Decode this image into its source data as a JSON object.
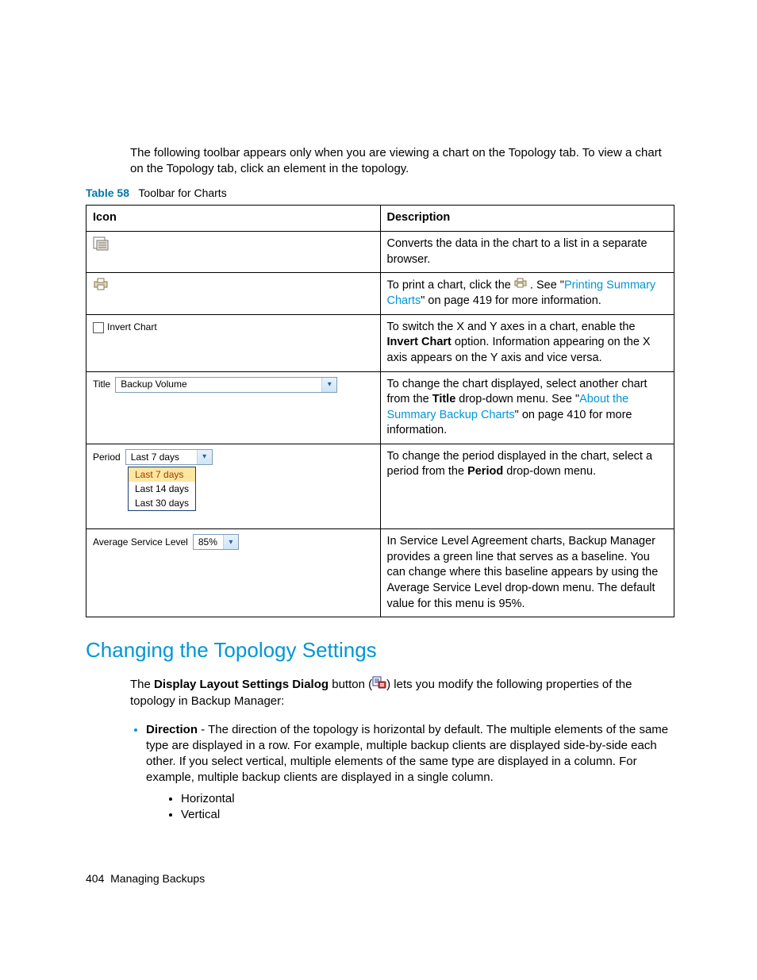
{
  "intro": "The following toolbar appears only when you are viewing a chart on the Topology tab. To view a chart on the Topology tab, click an element in the topology.",
  "table": {
    "caption_number": "Table 58",
    "caption_text": "Toolbar for Charts",
    "head_icon": "Icon",
    "head_desc": "Description",
    "rows": {
      "r0": {
        "desc": "Converts the data in the chart to a list in a separate browser."
      },
      "r1": {
        "desc_pre": "To print a chart, click the ",
        "desc_post": " . See \"",
        "link": "Printing Summary Charts",
        "tail": "\" on page 419 for more information."
      },
      "r2": {
        "ui_label": "Invert Chart",
        "desc_a": "To switch the X and Y axes in a chart, enable the ",
        "bold": "Invert Chart",
        "desc_b": " option. Information appearing on the X axis appears on the Y axis and vice versa."
      },
      "r3": {
        "ui_label": "Title",
        "ui_value": "Backup Volume",
        "desc_a": "To change the chart displayed, select another chart from the ",
        "bold": "Title",
        "desc_b": " drop-down menu. See \"",
        "link": "About the Summary Backup Charts",
        "tail": "\" on page 410 for more information."
      },
      "r4": {
        "ui_label": "Period",
        "ui_value": "Last 7 days",
        "opts": [
          "Last 7 days",
          "Last 14 days",
          "Last 30 days"
        ],
        "desc_a": "To change the period displayed in the chart, select a period from the ",
        "bold": "Period",
        "desc_b": " drop-down menu."
      },
      "r5": {
        "ui_label": "Average Service Level",
        "ui_value": "85%",
        "desc": "In Service Level Agreement charts, Backup Manager provides a green line that serves as a baseline. You can change where this baseline appears by using the Average Service Level drop-down menu. The default value for this menu is 95%."
      }
    }
  },
  "section_heading": "Changing the Topology Settings",
  "para": {
    "a": "The ",
    "b": "Display Layout Settings Dialog",
    "c": " button (",
    "d": ") lets you modify the following properties of the topology in Backup Manager:"
  },
  "bullet": {
    "label": "Direction",
    "text": " - The direction of the topology is horizontal by default. The multiple elements of the same type are displayed in a row. For example, multiple backup clients are displayed side-by-side each other. If you select vertical, multiple elements of the same type are displayed in a column. For example, multiple backup clients are displayed in a single column.",
    "sub1": "Horizontal",
    "sub2": "Vertical"
  },
  "footer_page": "404",
  "footer_text": "Managing Backups"
}
